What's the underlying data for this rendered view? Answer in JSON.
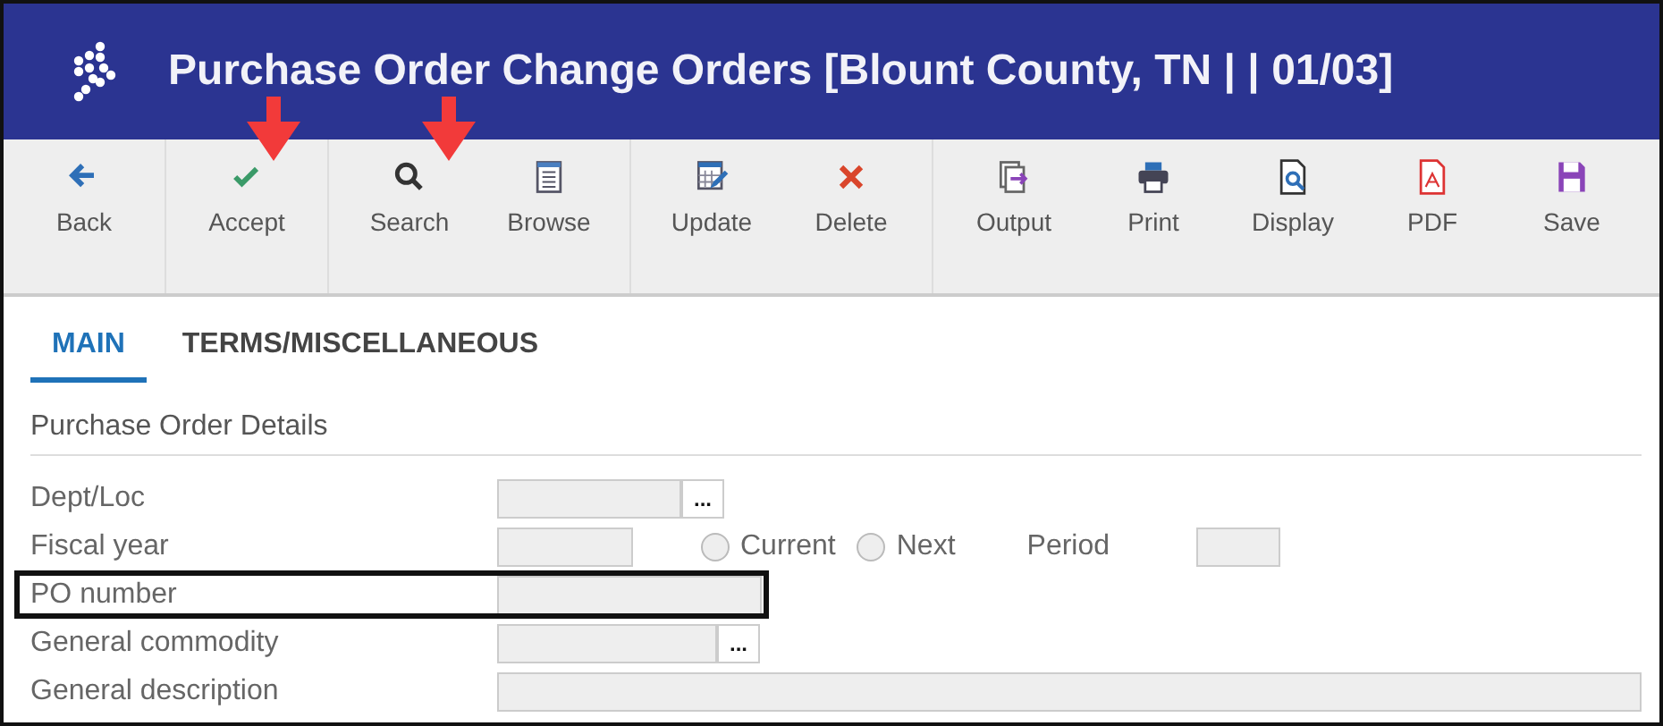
{
  "window": {
    "title": "Purchase Order Change Orders [Blount County, TN | | 01/03]"
  },
  "toolbar": {
    "groups": [
      [
        {
          "label": "Back",
          "kind": "back"
        }
      ],
      [
        {
          "label": "Accept",
          "kind": "accept"
        }
      ],
      [
        {
          "label": "Search",
          "kind": "search"
        },
        {
          "label": "Browse",
          "kind": "browse"
        }
      ],
      [
        {
          "label": "Update",
          "kind": "update"
        },
        {
          "label": "Delete",
          "kind": "delete"
        }
      ],
      [
        {
          "label": "Output",
          "kind": "output"
        },
        {
          "label": "Print",
          "kind": "print"
        },
        {
          "label": "Display",
          "kind": "display"
        },
        {
          "label": "PDF",
          "kind": "pdf"
        },
        {
          "label": "Save",
          "kind": "save"
        }
      ]
    ]
  },
  "tabs": [
    {
      "label": "MAIN",
      "selected": true
    },
    {
      "label": "TERMS/MISCELLANEOUS",
      "selected": false
    }
  ],
  "section": {
    "title": "Purchase Order Details"
  },
  "form": {
    "rows": [
      {
        "label": "Dept/Loc",
        "kind": "lookup",
        "highlighted": false,
        "lookup_button": "..."
      },
      {
        "label": "Fiscal year",
        "kind": "year",
        "highlighted": false,
        "radios": [
          {
            "label": "Current",
            "checked": false
          },
          {
            "label": "Next",
            "checked": false
          }
        ],
        "period_label": "Period"
      },
      {
        "label": "PO number",
        "kind": "text",
        "highlighted": true
      },
      {
        "label": "General commodity",
        "kind": "lookup_wide",
        "highlighted": false,
        "lookup_button": "..."
      },
      {
        "label": "General description",
        "kind": "full",
        "highlighted": false
      }
    ]
  }
}
